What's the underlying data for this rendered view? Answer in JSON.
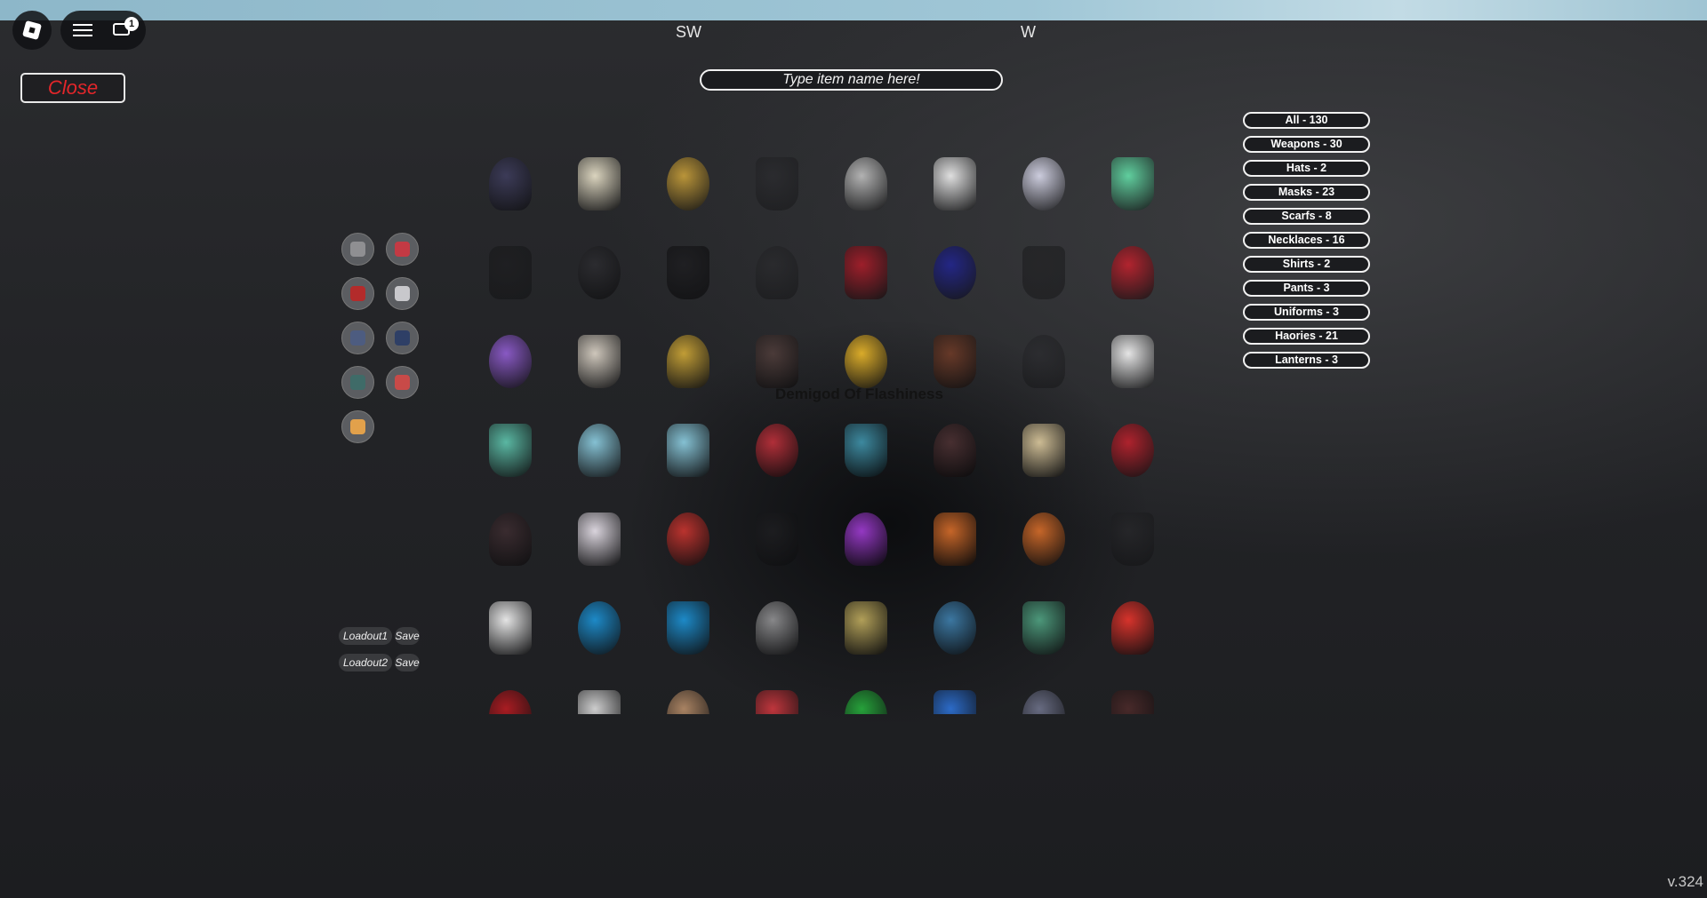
{
  "compass": {
    "left": "SW",
    "right": "W"
  },
  "topbar": {
    "notification_count": "1"
  },
  "close_label": "Close",
  "search": {
    "placeholder": "Type item name here!"
  },
  "categories": [
    {
      "label": "All - 130"
    },
    {
      "label": "Weapons - 30"
    },
    {
      "label": "Hats - 2"
    },
    {
      "label": "Masks - 23"
    },
    {
      "label": "Scarfs - 8"
    },
    {
      "label": "Necklaces - 16"
    },
    {
      "label": "Shirts - 2"
    },
    {
      "label": "Pants - 3"
    },
    {
      "label": "Uniforms - 3"
    },
    {
      "label": "Haories - 21"
    },
    {
      "label": "Lanterns - 3"
    }
  ],
  "loadouts": [
    {
      "label": "Loadout1",
      "save": "Save"
    },
    {
      "label": "Loadout2",
      "save": "Save"
    }
  ],
  "equipped_colors": [
    "#8f8f92",
    "#c33a44",
    "#b32b2b",
    "#c8c8cc",
    "#4d5c80",
    "#2e3f66",
    "#3f6b68",
    "#c84a48",
    "#e2a14b"
  ],
  "hover_tooltip": "Demigod Of Flashiness",
  "version": "v.324",
  "item_colors": [
    [
      "#3d3c5a",
      "#e4ddc6",
      "#c19a3a",
      "#2a2a2e",
      "#b9b9b9",
      "#e8e8e8",
      "#d4d4e6",
      "#62d6a3"
    ],
    [
      "#1a1a1c",
      "#2c2c30",
      "#1f1f22",
      "#2a2a2d",
      "#a31e2a",
      "#23268a",
      "#1c1c1e",
      "#b8232e"
    ],
    [
      "#8e5ccc",
      "#d7cfc3",
      "#c9a337",
      "#4d3c3a",
      "#e3b22a",
      "#6a3a28",
      "#2a2a2e",
      "#eeeeee"
    ],
    [
      "#5dbfa9",
      "#8ac9dc",
      "#8ac9dc",
      "#b8303a",
      "#3f8fa6",
      "#4a3032",
      "#d6c49a",
      "#b5222d"
    ],
    [
      "#3b2c30",
      "#e3dde6",
      "#c2342f",
      "#222225",
      "#9b3bcc",
      "#cf6a2a",
      "#cf6a2a",
      "#2a2a2d"
    ],
    [
      "#eeeeee",
      "#1d8fd0",
      "#1d8fd0",
      "#8d8d8f",
      "#b9a65c",
      "#3e7ca8",
      "#4f9e7f",
      "#e0342c"
    ],
    [
      "#b01c22",
      "#d6d6d6",
      "#b08866",
      "#c7373e",
      "#27a83c",
      "#2d6fd0",
      "#6b6f86",
      "#4a2a2a"
    ]
  ]
}
